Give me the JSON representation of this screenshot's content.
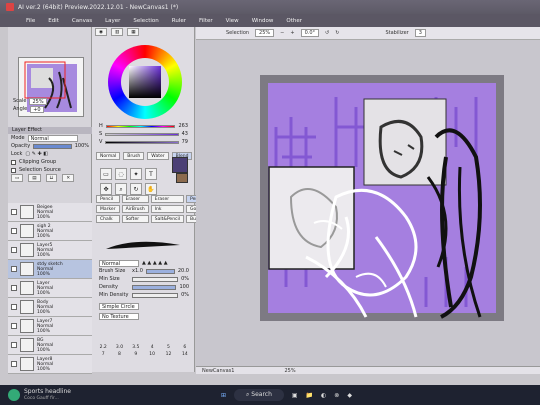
{
  "window": {
    "title": "AI ver.2 (64bit) Preview.2022.12.01 - NewCanvas1 (*)"
  },
  "menu": [
    "File",
    "Edit",
    "Canvas",
    "Layer",
    "Selection",
    "Ruler",
    "Filter",
    "View",
    "Window",
    "Other"
  ],
  "toolbar": {
    "selection_label": "Selection",
    "zoom": "25%",
    "angle": "0.0°",
    "stabilizer_label": "Stabilizer",
    "stabilizer_value": "3"
  },
  "navigator": {
    "scale_label": "Scale",
    "scale_value": "25%",
    "angle_label": "Angle",
    "angle_value": "+0"
  },
  "layer_effect": {
    "header": "Layer Effect",
    "mode_label": "Mode",
    "mode_value": "Normal",
    "opacity_label": "Opacity",
    "opacity_value": "100%",
    "lock_label": "Lock",
    "clipping_group": "Clipping Group",
    "selection_source": "Selection Source"
  },
  "layers": [
    {
      "name": "Beigee",
      "mode": "Normal",
      "opacity": "100%"
    },
    {
      "name": "sigh 2",
      "mode": "Normal",
      "opacity": "100%"
    },
    {
      "name": "Layer5",
      "mode": "Normal",
      "opacity": "100%"
    },
    {
      "name": "stdy sketch",
      "mode": "Normal",
      "opacity": "100%"
    },
    {
      "name": "Layer",
      "mode": "Normal",
      "opacity": "100%"
    },
    {
      "name": "Body",
      "mode": "Normal",
      "opacity": "100%"
    },
    {
      "name": "Layer7",
      "mode": "Normal",
      "opacity": "100%"
    },
    {
      "name": "BG",
      "mode": "Normal",
      "opacity": "100%"
    },
    {
      "name": "Layer8",
      "mode": "Normal",
      "opacity": "100%"
    }
  ],
  "color": {
    "h_label": "H",
    "s_label": "S",
    "v_label": "V",
    "h": "263",
    "s": "43",
    "v": "79",
    "primary": "#4b3f75",
    "accent": "#7b4fd0"
  },
  "tools": {
    "row_labels": [
      "Normal",
      "Brush",
      "Water",
      "Blend"
    ],
    "brush_names": [
      "Pencil",
      "Eraser",
      "Eraser",
      "Pencil",
      "Marker",
      "AirBrush",
      "Ink",
      "Gouache",
      "Chalk",
      "Softer",
      "Salt&Pencil",
      "Bucket"
    ]
  },
  "brush": {
    "mode_value": "Normal",
    "size_label": "Brush Size",
    "size_mult": "x1.0",
    "size_value": "20.0",
    "min_size_label": "Min Size",
    "min_size_value": "0%",
    "density_label": "Density",
    "density_value": "100",
    "min_density_label": "Min Density",
    "min_density_value": "0%",
    "circle_label": "Simple Circle",
    "texture_label": "No Texture",
    "sizes": [
      "2.2",
      "3.0",
      "3.5",
      "4",
      "5",
      "6",
      "7",
      "8",
      "9",
      "10",
      "12",
      "14"
    ]
  },
  "status": {
    "canvas_name": "NewCanvas1",
    "zoom": "25%"
  },
  "taskbar": {
    "weather": "Sports headline",
    "weather_sub": "Coco Gauff fir...",
    "search_label": "Search"
  }
}
